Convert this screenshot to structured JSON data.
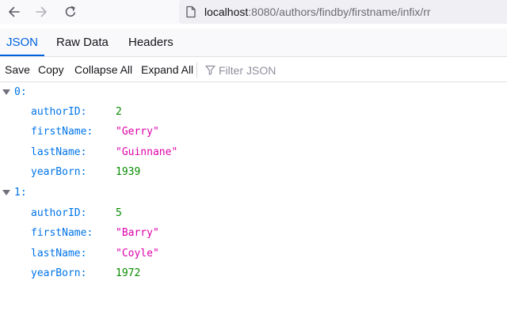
{
  "navbar": {
    "back_icon": "arrow-left-icon",
    "forward_icon": "arrow-right-icon",
    "reload_icon": "reload-icon",
    "page_icon": "page-icon",
    "url_host": "localhost",
    "url_path": ":8080/authors/findby/firstname/infix/rr"
  },
  "tabs": [
    {
      "label": "JSON",
      "active": true
    },
    {
      "label": "Raw Data",
      "active": false
    },
    {
      "label": "Headers",
      "active": false
    }
  ],
  "toolbar": {
    "save_label": "Save",
    "copy_label": "Copy",
    "collapse_label": "Collapse All",
    "expand_label": "Expand All",
    "filter_icon": "filter-icon",
    "filter_placeholder": "Filter JSON"
  },
  "json": [
    {
      "index": "0:",
      "fields": [
        {
          "key": "authorID:",
          "value": "2",
          "type": "number"
        },
        {
          "key": "firstName:",
          "value": "\"Gerry\"",
          "type": "string"
        },
        {
          "key": "lastName:",
          "value": "\"Guinnane\"",
          "type": "string"
        },
        {
          "key": "yearBorn:",
          "value": "1939",
          "type": "number"
        }
      ]
    },
    {
      "index": "1:",
      "fields": [
        {
          "key": "authorID:",
          "value": "5",
          "type": "number"
        },
        {
          "key": "firstName:",
          "value": "\"Barry\"",
          "type": "string"
        },
        {
          "key": "lastName:",
          "value": "\"Coyle\"",
          "type": "string"
        },
        {
          "key": "yearBorn:",
          "value": "1972",
          "type": "number"
        }
      ]
    }
  ],
  "colors": {
    "accent": "#0061e0",
    "key": "#0074e8",
    "number": "#058b00",
    "string": "#dd00a9"
  }
}
